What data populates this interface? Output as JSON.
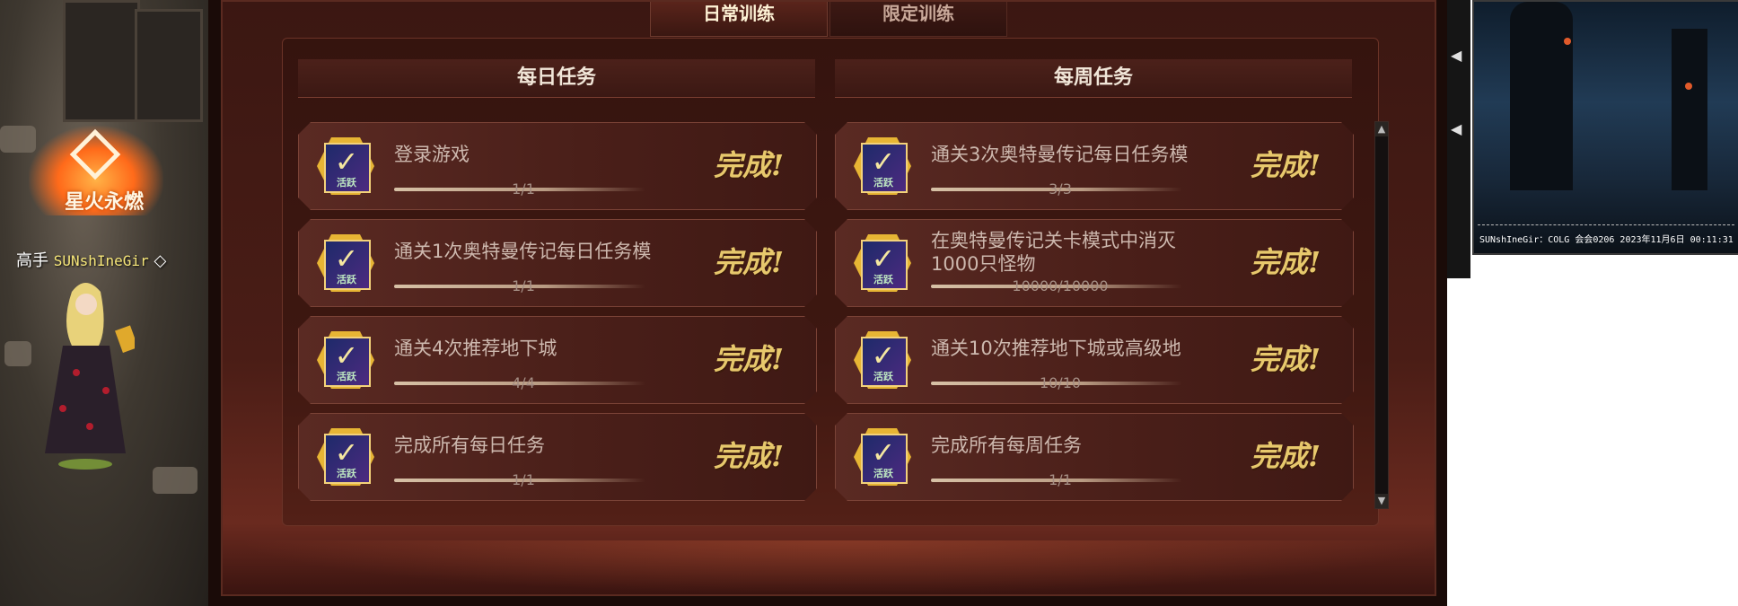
{
  "scene": {
    "guild_name": "星火永燃",
    "player_title": "高手",
    "player_nick": "SUNshIneGir"
  },
  "tabs": [
    {
      "label": "日常训练",
      "active": true
    },
    {
      "label": "限定训练",
      "active": false
    }
  ],
  "daily": {
    "header": "每日任务",
    "tasks": [
      {
        "title": "登录游戏",
        "progress": "1/1",
        "status": "完成!"
      },
      {
        "title": "通关1次奥特曼传记每日任务模",
        "progress": "1/1",
        "status": "完成!"
      },
      {
        "title": "通关4次推荐地下城",
        "progress": "4/4",
        "status": "完成!"
      },
      {
        "title": "完成所有每日任务",
        "progress": "1/1",
        "status": "完成!"
      }
    ]
  },
  "weekly": {
    "header": "每周任务",
    "tasks": [
      {
        "title": "通关3次奥特曼传记每日任务模",
        "progress": "3/3",
        "status": "完成!"
      },
      {
        "title": "在奥特曼传记关卡模式中消灭1000只怪物",
        "progress": "10000/10000",
        "status": "完成!"
      },
      {
        "title": "通关10次推荐地下城或高级地",
        "progress": "10/10",
        "status": "完成!"
      },
      {
        "title": "完成所有每周任务",
        "progress": "1/1",
        "status": "完成!"
      }
    ]
  },
  "reward_tag": "活跃",
  "icons": {
    "check": "check-icon",
    "scroll_up": "chevron-up-icon",
    "scroll_down": "chevron-down-icon",
    "side_left": "chevron-left-icon"
  },
  "stream": {
    "caption": "SUNshIneGir：COLG 会会0206 2023年11月6日 00:11:31"
  },
  "colors": {
    "accent_gold": "#e7c86c",
    "panel_bg": "#4a1d16"
  }
}
